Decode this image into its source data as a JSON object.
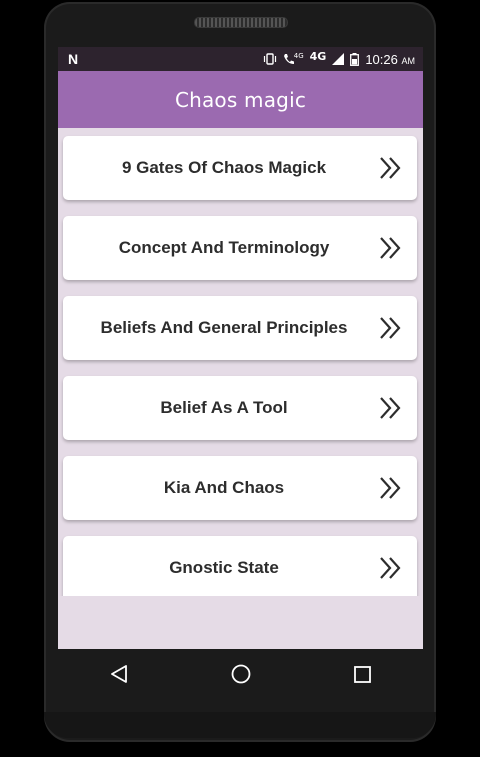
{
  "status_bar": {
    "network": "4G",
    "call_network": "4G",
    "time": "10:26",
    "ampm": "AM"
  },
  "app_bar": {
    "title": "Chaos magic"
  },
  "topics": [
    {
      "label": "9 Gates Of Chaos Magick"
    },
    {
      "label": "Concept And Terminology"
    },
    {
      "label": "Beliefs And General Principles"
    },
    {
      "label": "Belief As A Tool"
    },
    {
      "label": "Kia And Chaos"
    },
    {
      "label": "Gnostic State"
    }
  ],
  "icons": {
    "card_arrow": "double-chevron-right-icon",
    "nav_back": "back-triangle-icon",
    "nav_home": "home-circle-icon",
    "nav_recents": "recents-square-icon"
  },
  "colors": {
    "app_bar": "#9b6ab0",
    "status_bar": "#2d232e",
    "screen_bg": "#e5dbe6",
    "card_bg": "#ffffff",
    "text": "#2d2d2d"
  }
}
